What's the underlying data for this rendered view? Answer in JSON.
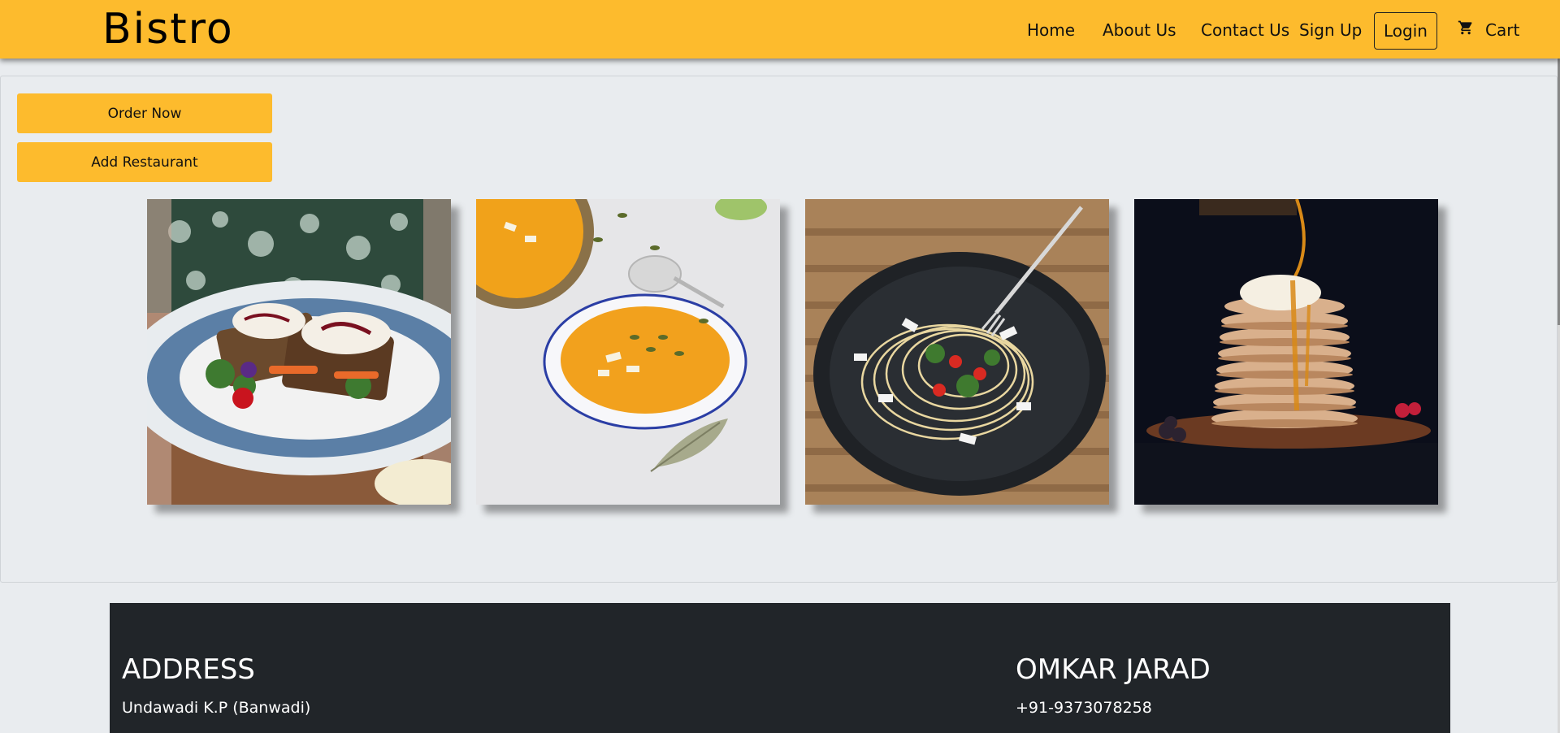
{
  "navbar": {
    "brand": "Bistro",
    "links": {
      "home": "Home",
      "about": "About Us",
      "contact": "Contact Us",
      "signup": "Sign Up"
    },
    "login": "Login",
    "cart": "Cart",
    "cart_icon": "shopping-cart-icon",
    "color": "#fdbb2d"
  },
  "actions": {
    "order_now": "Order Now",
    "add_restaurant": "Add Restaurant"
  },
  "gallery": [
    {
      "name": "salad-toast-plate-image"
    },
    {
      "name": "pumpkin-soup-bowl-image"
    },
    {
      "name": "spaghetti-plate-image"
    },
    {
      "name": "pancake-stack-image"
    }
  ],
  "footer": {
    "address_heading": "ADDRESS",
    "address_text": "Undawadi K.P (Banwadi)",
    "contact_heading": "OMKAR JARAD",
    "contact_text": "+91-9373078258",
    "background": "#212529"
  }
}
